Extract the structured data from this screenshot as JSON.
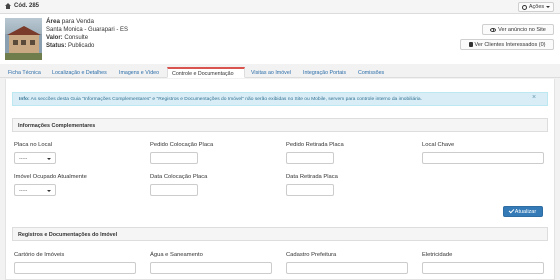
{
  "topbar": {
    "code": "Cód. 285",
    "acoes_label": "Ações"
  },
  "header": {
    "title_main": "Área",
    "title_rest": " para Venda",
    "location": "Santa Monica - Guarapari - ES",
    "valor_label": "Valor:",
    "valor_value": " Consulte",
    "status_label": "Status:",
    "status_value": " Publicado",
    "ver_site_label": "Ver anúncio no Site",
    "ver_clientes_label": "Ver Clientes Interessados (0)"
  },
  "tabs": [
    {
      "label": "Ficha Técnica"
    },
    {
      "label": "Localização e Detalhes"
    },
    {
      "label": "Imagens e Vídeo"
    },
    {
      "label": "Controle e Documentação"
    },
    {
      "label": "Visitas ao Imóvel"
    },
    {
      "label": "Integração Portais"
    },
    {
      "label": "Comissões"
    }
  ],
  "active_tab": "Controle e Documentação",
  "alert": {
    "prefix": "Info:",
    "text": " As seccões desta Guia \"Informações Complementares\" e \"Registros e Documentações do Imóvel\" não serão exibidas no Site ou Mobile, servem para controle interno da imobiliária.",
    "close": "×"
  },
  "sections": {
    "info_title": "Informações Complementares",
    "registros_title": "Registros e Documentações do Imóvel"
  },
  "fields": {
    "placa_no_local": "Placa no Local",
    "placa_no_local_value": "-----",
    "pedido_colocacao_placa": "Pedido Colocação Placa",
    "pedido_retirada_placa": "Pedido Retirada Placa",
    "local_chave": "Local Chave",
    "imovel_ocupado": "Imóvel Ocupado Atualmente",
    "imovel_ocupado_value": "-----",
    "data_colocacao_placa": "Data Colocação Placa",
    "data_retirada_placa": "Data Retirada Placa",
    "cartorio": "Cartório de Imóveis",
    "agua": "Água e Saneamento",
    "cadastro_prefeitura": "Cadastro Prefeitura",
    "eletricidade": "Eletricidade"
  },
  "atualizar_label": "Atualizar",
  "colors": {
    "accent": "#337ab7",
    "active_tab_border": "#d9534f",
    "info_bg": "#d9edf7"
  }
}
